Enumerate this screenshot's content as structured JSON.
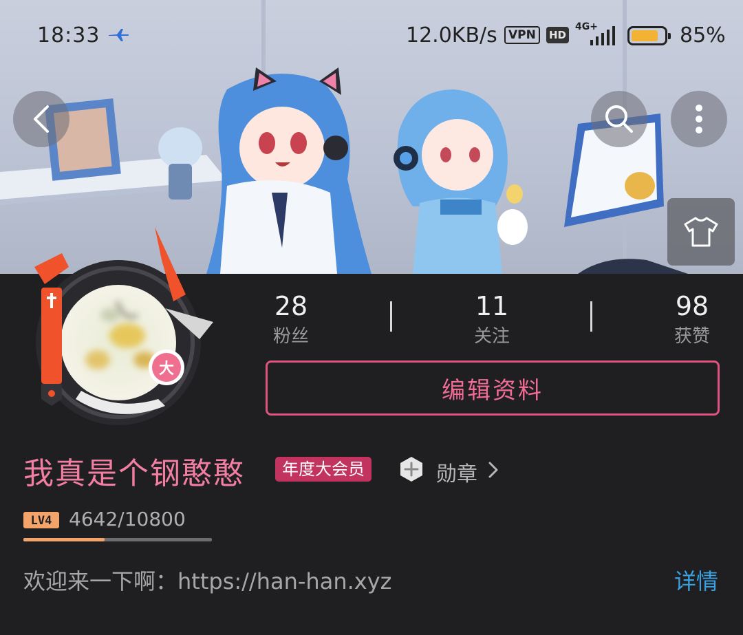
{
  "status_bar": {
    "time": "18:33",
    "net_speed": "12.0KB/s",
    "vpn_label": "VPN",
    "hd_label": "HD",
    "network_type": "4G+",
    "battery_percent_text": "85%",
    "battery_level": 0.85,
    "airplane_icon": "airplane-icon",
    "signal_icon": "signal-icon"
  },
  "header": {
    "back_icon": "chevron-left-icon",
    "search_icon": "search-icon",
    "more_icon": "more-vertical-icon",
    "theme_icon": "tshirt-icon"
  },
  "profile": {
    "avatar_badge": "大",
    "stats": [
      {
        "value": "28",
        "label": "粉丝"
      },
      {
        "value": "11",
        "label": "关注"
      },
      {
        "value": "98",
        "label": "获赞"
      }
    ],
    "edit_button_label": "编辑资料",
    "username": "我真是个钢憨憨",
    "vip_badge": "年度大会员",
    "medal_label": "勋章",
    "level_label": "LV4",
    "exp_text": "4642/10800",
    "exp_progress": 0.4298,
    "bio": "欢迎来一下啊：https://han-han.xyz",
    "detail_label": "详情"
  },
  "colors": {
    "accent_pink": "#f06c95",
    "vip_badge_bg": "#c2335f",
    "link_blue": "#3aa0e0",
    "exp_fill": "#f3a46a",
    "page_bg": "#1f1e20"
  }
}
